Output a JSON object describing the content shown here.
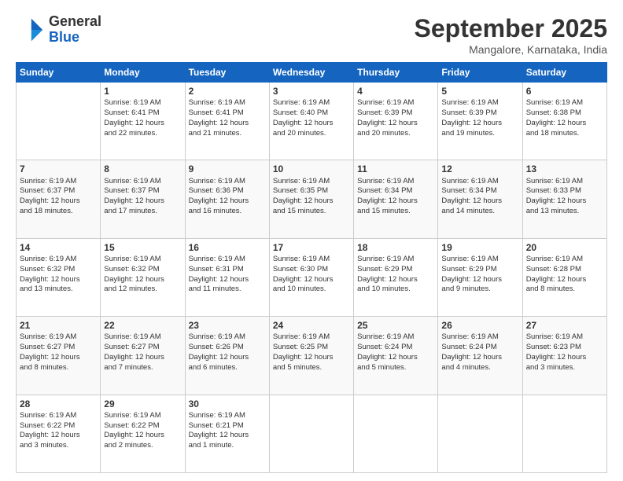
{
  "logo": {
    "line1": "General",
    "line2": "Blue"
  },
  "title": "September 2025",
  "subtitle": "Mangalore, Karnataka, India",
  "days": [
    "Sunday",
    "Monday",
    "Tuesday",
    "Wednesday",
    "Thursday",
    "Friday",
    "Saturday"
  ],
  "weeks": [
    [
      {
        "num": "",
        "info": ""
      },
      {
        "num": "1",
        "info": "Sunrise: 6:19 AM\nSunset: 6:41 PM\nDaylight: 12 hours\nand 22 minutes."
      },
      {
        "num": "2",
        "info": "Sunrise: 6:19 AM\nSunset: 6:41 PM\nDaylight: 12 hours\nand 21 minutes."
      },
      {
        "num": "3",
        "info": "Sunrise: 6:19 AM\nSunset: 6:40 PM\nDaylight: 12 hours\nand 20 minutes."
      },
      {
        "num": "4",
        "info": "Sunrise: 6:19 AM\nSunset: 6:39 PM\nDaylight: 12 hours\nand 20 minutes."
      },
      {
        "num": "5",
        "info": "Sunrise: 6:19 AM\nSunset: 6:39 PM\nDaylight: 12 hours\nand 19 minutes."
      },
      {
        "num": "6",
        "info": "Sunrise: 6:19 AM\nSunset: 6:38 PM\nDaylight: 12 hours\nand 18 minutes."
      }
    ],
    [
      {
        "num": "7",
        "info": "Sunrise: 6:19 AM\nSunset: 6:37 PM\nDaylight: 12 hours\nand 18 minutes."
      },
      {
        "num": "8",
        "info": "Sunrise: 6:19 AM\nSunset: 6:37 PM\nDaylight: 12 hours\nand 17 minutes."
      },
      {
        "num": "9",
        "info": "Sunrise: 6:19 AM\nSunset: 6:36 PM\nDaylight: 12 hours\nand 16 minutes."
      },
      {
        "num": "10",
        "info": "Sunrise: 6:19 AM\nSunset: 6:35 PM\nDaylight: 12 hours\nand 15 minutes."
      },
      {
        "num": "11",
        "info": "Sunrise: 6:19 AM\nSunset: 6:34 PM\nDaylight: 12 hours\nand 15 minutes."
      },
      {
        "num": "12",
        "info": "Sunrise: 6:19 AM\nSunset: 6:34 PM\nDaylight: 12 hours\nand 14 minutes."
      },
      {
        "num": "13",
        "info": "Sunrise: 6:19 AM\nSunset: 6:33 PM\nDaylight: 12 hours\nand 13 minutes."
      }
    ],
    [
      {
        "num": "14",
        "info": "Sunrise: 6:19 AM\nSunset: 6:32 PM\nDaylight: 12 hours\nand 13 minutes."
      },
      {
        "num": "15",
        "info": "Sunrise: 6:19 AM\nSunset: 6:32 PM\nDaylight: 12 hours\nand 12 minutes."
      },
      {
        "num": "16",
        "info": "Sunrise: 6:19 AM\nSunset: 6:31 PM\nDaylight: 12 hours\nand 11 minutes."
      },
      {
        "num": "17",
        "info": "Sunrise: 6:19 AM\nSunset: 6:30 PM\nDaylight: 12 hours\nand 10 minutes."
      },
      {
        "num": "18",
        "info": "Sunrise: 6:19 AM\nSunset: 6:29 PM\nDaylight: 12 hours\nand 10 minutes."
      },
      {
        "num": "19",
        "info": "Sunrise: 6:19 AM\nSunset: 6:29 PM\nDaylight: 12 hours\nand 9 minutes."
      },
      {
        "num": "20",
        "info": "Sunrise: 6:19 AM\nSunset: 6:28 PM\nDaylight: 12 hours\nand 8 minutes."
      }
    ],
    [
      {
        "num": "21",
        "info": "Sunrise: 6:19 AM\nSunset: 6:27 PM\nDaylight: 12 hours\nand 8 minutes."
      },
      {
        "num": "22",
        "info": "Sunrise: 6:19 AM\nSunset: 6:27 PM\nDaylight: 12 hours\nand 7 minutes."
      },
      {
        "num": "23",
        "info": "Sunrise: 6:19 AM\nSunset: 6:26 PM\nDaylight: 12 hours\nand 6 minutes."
      },
      {
        "num": "24",
        "info": "Sunrise: 6:19 AM\nSunset: 6:25 PM\nDaylight: 12 hours\nand 5 minutes."
      },
      {
        "num": "25",
        "info": "Sunrise: 6:19 AM\nSunset: 6:24 PM\nDaylight: 12 hours\nand 5 minutes."
      },
      {
        "num": "26",
        "info": "Sunrise: 6:19 AM\nSunset: 6:24 PM\nDaylight: 12 hours\nand 4 minutes."
      },
      {
        "num": "27",
        "info": "Sunrise: 6:19 AM\nSunset: 6:23 PM\nDaylight: 12 hours\nand 3 minutes."
      }
    ],
    [
      {
        "num": "28",
        "info": "Sunrise: 6:19 AM\nSunset: 6:22 PM\nDaylight: 12 hours\nand 3 minutes."
      },
      {
        "num": "29",
        "info": "Sunrise: 6:19 AM\nSunset: 6:22 PM\nDaylight: 12 hours\nand 2 minutes."
      },
      {
        "num": "30",
        "info": "Sunrise: 6:19 AM\nSunset: 6:21 PM\nDaylight: 12 hours\nand 1 minute."
      },
      {
        "num": "",
        "info": ""
      },
      {
        "num": "",
        "info": ""
      },
      {
        "num": "",
        "info": ""
      },
      {
        "num": "",
        "info": ""
      }
    ]
  ]
}
